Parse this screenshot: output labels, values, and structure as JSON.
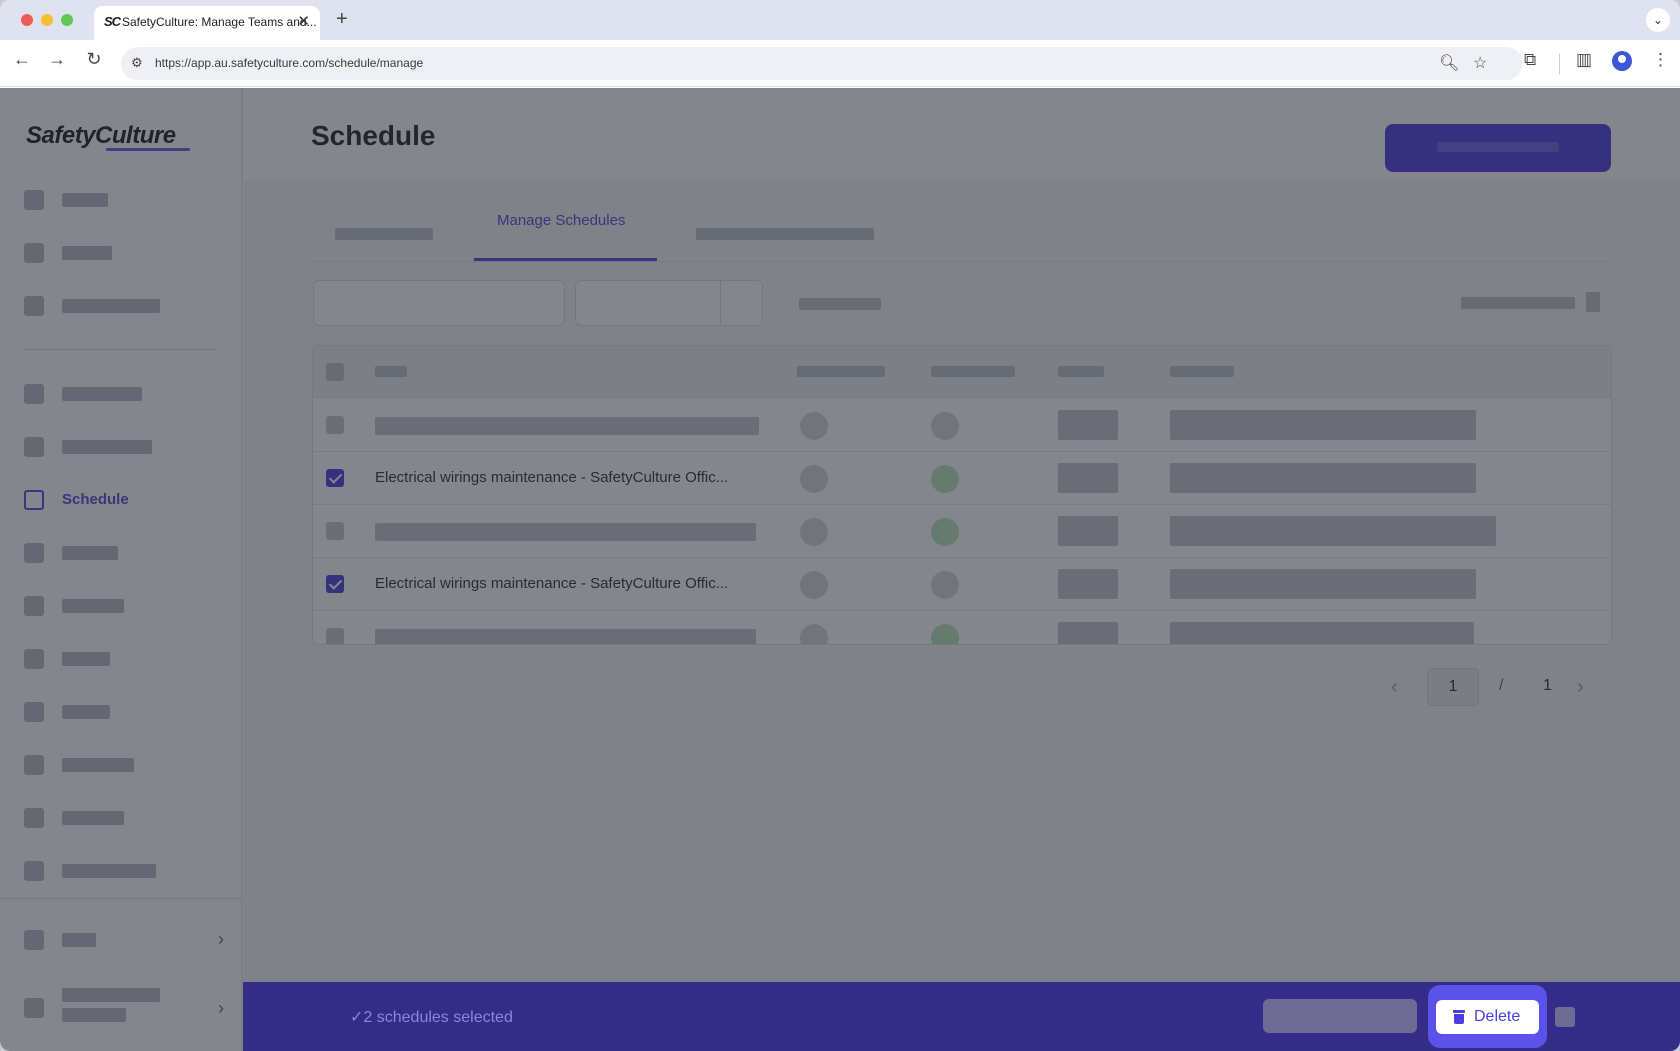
{
  "browser": {
    "tab_title": "SafetyCulture: Manage Teams and...",
    "tab_favicon": "SC",
    "url": "https://app.au.safetyculture.com/schedule/manage"
  },
  "app": {
    "logo": "SafetyCulture",
    "sidebar_active_label": "Schedule",
    "page_title": "Schedule",
    "active_tab": "Manage Schedules",
    "rows": [
      {
        "name": "",
        "checked": false
      },
      {
        "name": "Electrical wirings maintenance - SafetyCulture Offic...",
        "checked": true
      },
      {
        "name": "",
        "checked": false
      },
      {
        "name": "Electrical wirings maintenance - SafetyCulture Offic...",
        "checked": true
      },
      {
        "name": "",
        "checked": false
      }
    ],
    "pagination": {
      "current": "1",
      "separator": "/",
      "total": "1"
    },
    "action_bar": {
      "selected_text": "✓2 schedules selected",
      "delete_label": "Delete"
    }
  },
  "colors": {
    "accent": "#4a3ee0",
    "action_bar": "#342c86"
  },
  "icons": [
    "trash-icon",
    "chevron-right-icon",
    "back-icon",
    "forward-icon",
    "reload-icon",
    "zoom-icon",
    "star-icon",
    "extensions-icon",
    "side-panel-icon",
    "profile-icon",
    "kebab-menu-icon"
  ]
}
